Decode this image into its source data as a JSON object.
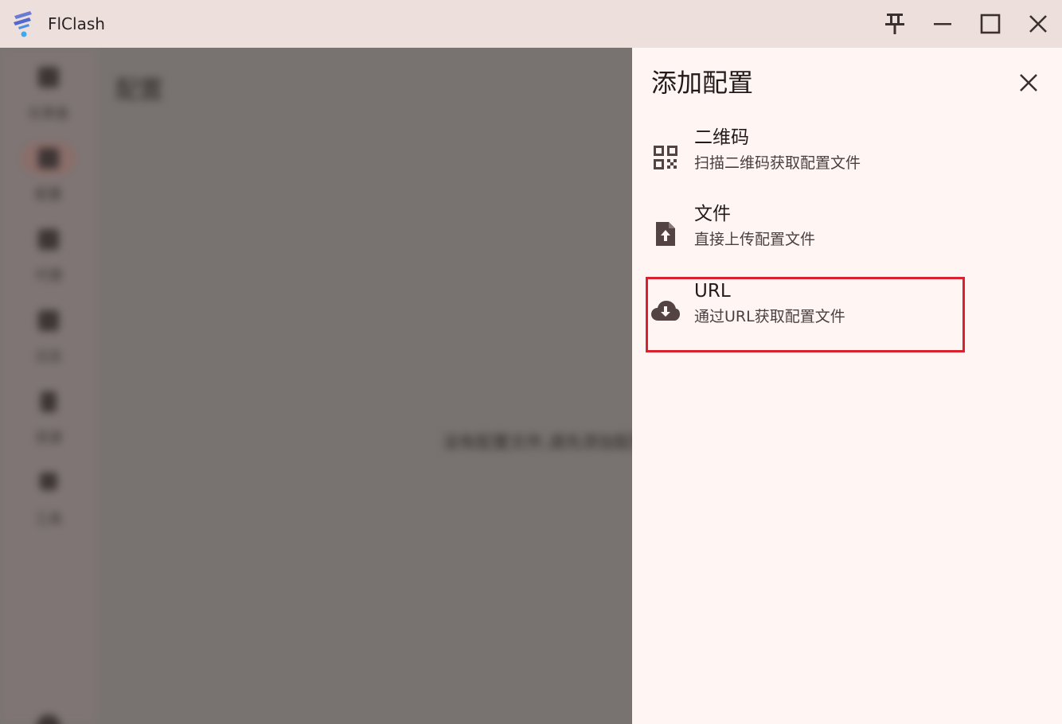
{
  "window": {
    "title": "FlClash",
    "controls": {
      "pin_icon": "pin-icon",
      "minimize_icon": "minimize-icon",
      "maximize_icon": "maximize-icon",
      "close_icon": "close-icon"
    }
  },
  "background": {
    "page_title": "配置",
    "empty_message": "没有配置文件,请先添加配置文件",
    "nav_items": [
      {
        "label": "仪表盘",
        "active": false
      },
      {
        "label": "配置",
        "active": true
      },
      {
        "label": "代理",
        "active": false
      },
      {
        "label": "日志",
        "active": false
      },
      {
        "label": "资源",
        "active": false
      },
      {
        "label": "工具",
        "active": false
      }
    ]
  },
  "sheet": {
    "title": "添加配置",
    "close_icon": "close-icon",
    "options": [
      {
        "title": "二维码",
        "subtitle": "扫描二维码获取配置文件",
        "icon": "qr-code-icon"
      },
      {
        "title": "文件",
        "subtitle": "直接上传配置文件",
        "icon": "file-upload-icon"
      },
      {
        "title": "URL",
        "subtitle": "通过URL获取配置文件",
        "icon": "cloud-download-icon"
      }
    ]
  },
  "colors": {
    "titlebar_bg": "#ede0dc",
    "sheet_bg": "#fff6f4",
    "scrim": "#787371",
    "icon": "#534342",
    "highlight": "#d9222d"
  }
}
